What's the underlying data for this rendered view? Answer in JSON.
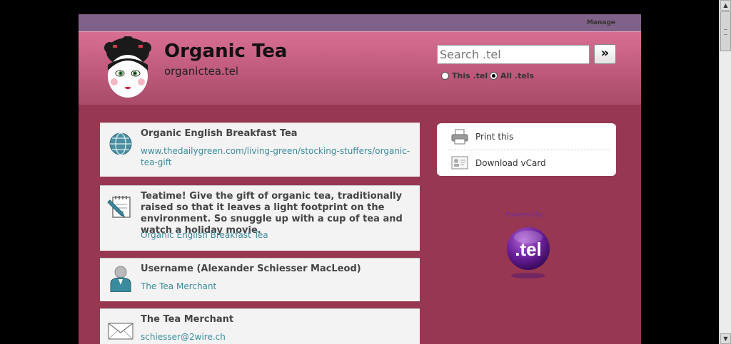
{
  "topbar": {
    "manage_label": "Manage"
  },
  "header": {
    "title": "Organic Tea",
    "subtitle": "organictea.tel"
  },
  "search": {
    "placeholder": "Search .tel",
    "go_label": "»",
    "scope_options": [
      {
        "label": "This .tel",
        "selected": false
      },
      {
        "label": "All .tels",
        "selected": true
      }
    ]
  },
  "records": [
    {
      "icon": "globe-icon",
      "title": "Organic English Breakfast Tea",
      "link": "www.thedailygreen.com/living-green/stocking-stuffers/organic-tea-gift"
    },
    {
      "icon": "note-pencil-icon",
      "title": "Teatime! Give the gift of organic tea, traditionally raised so that it leaves a light footprint on the environment. So snuggle up with a cup of tea and watch a holiday movie.",
      "link": "Organic English Breakfast Tea"
    },
    {
      "icon": "person-icon",
      "title": "Username (Alexander Schiesser MacLeod)",
      "link": "The Tea Merchant"
    },
    {
      "icon": "envelope-icon",
      "title": "The Tea Merchant",
      "link": "schiesser@2wire.ch"
    }
  ],
  "sidebar": {
    "print_label": "Print this",
    "vcard_label": "Download vCard",
    "powered_by": "Powered by:",
    "logo_text": ".tel"
  },
  "colors": {
    "page_bg": "#973751",
    "topbar": "#806189",
    "header": "#c9607f",
    "link": "#3b8b9e"
  }
}
